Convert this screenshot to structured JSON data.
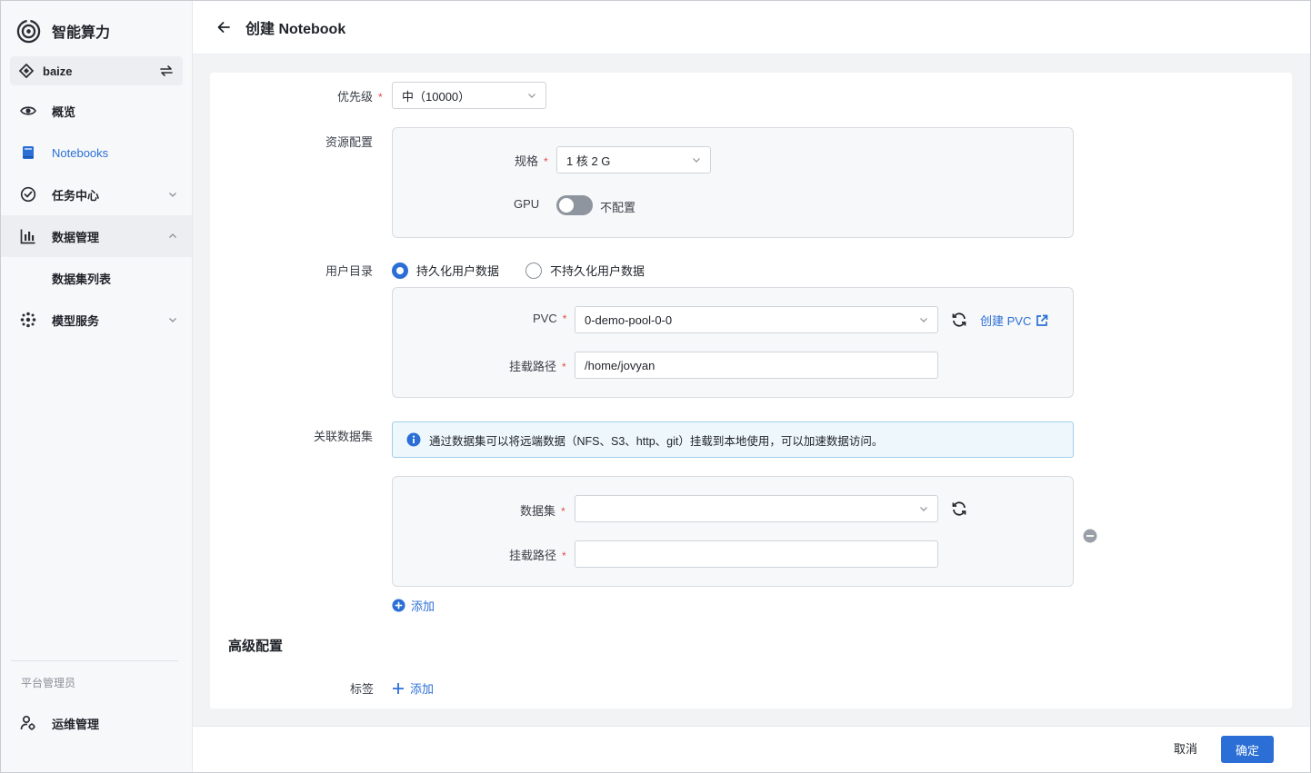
{
  "app": {
    "name": "智能算力"
  },
  "workspace": {
    "name": "baize",
    "switch_icon": "swap-icon"
  },
  "sidebar": {
    "items": [
      {
        "label": "概览",
        "icon": "eye-icon"
      },
      {
        "label": "Notebooks",
        "icon": "notebook-icon",
        "active": true
      },
      {
        "label": "任务中心",
        "icon": "task-check-icon"
      },
      {
        "label": "数据管理",
        "icon": "bar-chart-icon",
        "open": true
      },
      {
        "label": "数据集列表"
      },
      {
        "label": "模型服务",
        "icon": "model-node-icon"
      }
    ],
    "section_title": "平台管理员",
    "admin_item": {
      "label": "运维管理",
      "icon": "user-gear-icon"
    }
  },
  "header": {
    "title": "创建 Notebook"
  },
  "form": {
    "priority": {
      "label": "优先级",
      "value": "中（10000）"
    },
    "resource": {
      "label": "资源配置",
      "spec_label": "规格",
      "spec_value": "1 核 2 G",
      "gpu_label": "GPU",
      "gpu_state": "不配置"
    },
    "user_dir": {
      "label": "用户目录",
      "option_persist": "持久化用户数据",
      "option_no_persist": "不持久化用户数据",
      "pvc_label": "PVC",
      "pvc_value": "0-demo-pool-0-0",
      "create_pvc": "创建 PVC",
      "mount_label": "挂载路径",
      "mount_value": "/home/jovyan"
    },
    "dataset": {
      "label": "关联数据集",
      "info": "通过数据集可以将远端数据（NFS、S3、http、git）挂载到本地使用，可以加速数据访问。",
      "dataset_label": "数据集",
      "dataset_value": "",
      "mount_label": "挂载路径",
      "mount_value": "",
      "add": "添加"
    },
    "advanced": {
      "title": "高级配置",
      "tags_label": "标签",
      "add": "添加"
    }
  },
  "footer": {
    "cancel": "取消",
    "confirm": "确定"
  },
  "colors": {
    "primary": "#2b6fd6",
    "required": "#e24c4c",
    "info_bg": "#eef7fc"
  }
}
